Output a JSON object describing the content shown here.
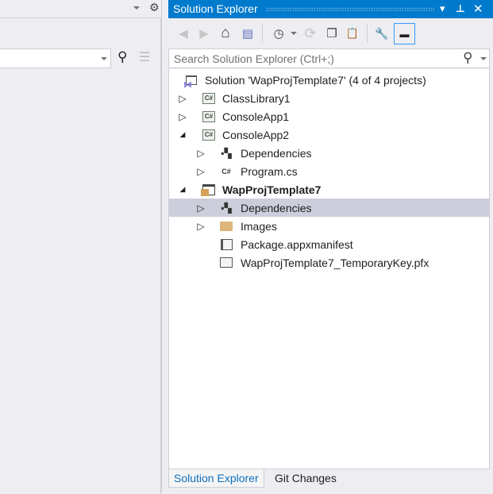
{
  "left_pane": {
    "search_icon": "search-icon",
    "filter_icon": "clear-filter-icon"
  },
  "title": {
    "text": "Solution Explorer",
    "dropdown": "▾",
    "pin": "📌",
    "close": "✕"
  },
  "toolbar": [
    {
      "name": "back-button",
      "icon": "◀"
    },
    {
      "name": "forward-button",
      "icon": "▶"
    },
    {
      "name": "home-button",
      "icon": "⌂"
    },
    {
      "name": "switch-views-button",
      "icon": "▤"
    },
    {
      "name": "pending-changes-filter-button",
      "icon": "◷"
    },
    {
      "name": "sync-button",
      "icon": "⟳"
    },
    {
      "name": "collapse-all-button",
      "icon": "❐"
    },
    {
      "name": "show-all-files-button",
      "icon": "📋"
    },
    {
      "name": "properties-button",
      "icon": "🔧"
    },
    {
      "name": "preview-button",
      "icon": "▬"
    }
  ],
  "search": {
    "placeholder": "Search Solution Explorer (Ctrl+;)"
  },
  "tree": [
    {
      "label": "Solution 'WapProjTemplate7' (4 of 4 projects)",
      "level": 0,
      "expander": "",
      "icon": "solution"
    },
    {
      "label": "ClassLibrary1",
      "level": 1,
      "expander": "▷",
      "icon": "csproj"
    },
    {
      "label": "ConsoleApp1",
      "level": 1,
      "expander": "▷",
      "icon": "csproj"
    },
    {
      "label": "ConsoleApp2",
      "level": 1,
      "expander": "◢",
      "icon": "csproj"
    },
    {
      "label": "Dependencies",
      "level": 2,
      "expander": "▷",
      "icon": "dependencies"
    },
    {
      "label": "Program.cs",
      "level": 2,
      "expander": "▷",
      "icon": "csfile"
    },
    {
      "label": "WapProjTemplate7",
      "level": 1,
      "expander": "◢",
      "icon": "package-project",
      "bold": true
    },
    {
      "label": "Dependencies",
      "level": 2,
      "expander": "▷",
      "icon": "dependencies",
      "selected": true
    },
    {
      "label": "Images",
      "level": 2,
      "expander": "▷",
      "icon": "folder"
    },
    {
      "label": "Package.appxmanifest",
      "level": 2,
      "expander": "",
      "icon": "manifest"
    },
    {
      "label": "WapProjTemplate7_TemporaryKey.pfx",
      "level": 2,
      "expander": "",
      "icon": "certificate"
    }
  ],
  "tabs": [
    {
      "label": "Solution Explorer",
      "active": true
    },
    {
      "label": "Git Changes",
      "active": false
    }
  ],
  "colors": {
    "accent": "#007acc",
    "selected": "#cccedb",
    "background": "#eeeef2"
  }
}
